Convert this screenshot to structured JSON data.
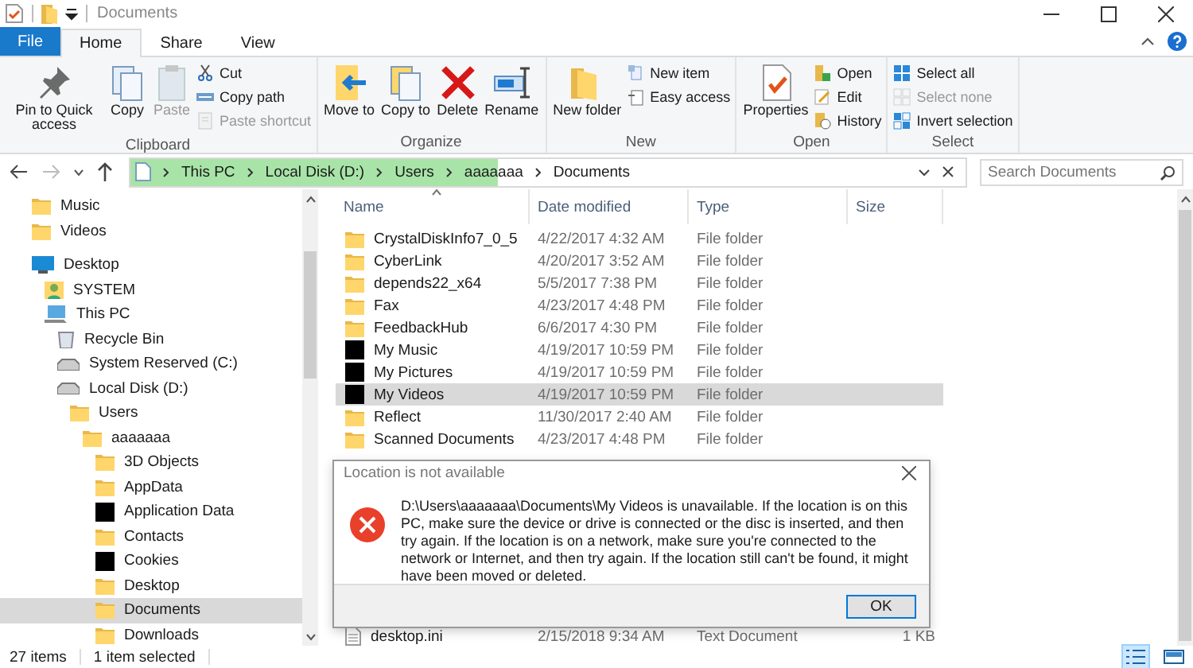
{
  "window": {
    "title": "Documents"
  },
  "tabs": [
    {
      "label": "File",
      "kind": "file-menu",
      "selected": false
    },
    {
      "label": "Home",
      "kind": "tab",
      "selected": true
    },
    {
      "label": "Share",
      "kind": "tab",
      "selected": false
    },
    {
      "label": "View",
      "kind": "tab",
      "selected": false
    }
  ],
  "ribbon": [
    {
      "label": "Clipboard",
      "large": [
        {
          "label": "Pin to Quick access",
          "kind": "pin",
          "disabled": false
        },
        {
          "label": "Copy",
          "kind": "copy",
          "disabled": false
        },
        {
          "label": "Paste",
          "kind": "paste",
          "disabled": true
        }
      ],
      "small": [
        {
          "label": "Cut",
          "kind": "cut",
          "disabled": false
        },
        {
          "label": "Copy path",
          "kind": "path",
          "disabled": false
        },
        {
          "label": "Paste shortcut",
          "kind": "shortcut",
          "disabled": true
        }
      ]
    },
    {
      "label": "Organize",
      "large": [
        {
          "label": "Move to",
          "kind": "move",
          "disabled": false
        },
        {
          "label": "Copy to",
          "kind": "copyto",
          "disabled": false
        },
        {
          "label": "Delete",
          "kind": "delete",
          "disabled": false
        },
        {
          "label": "Rename",
          "kind": "rename",
          "disabled": false
        }
      ]
    },
    {
      "label": "New",
      "large": [
        {
          "label": "New folder",
          "kind": "folder",
          "disabled": false
        }
      ],
      "small": [
        {
          "label": "New item",
          "kind": "newitem",
          "disabled": false
        },
        {
          "label": "Easy access",
          "kind": "easy",
          "disabled": false
        }
      ]
    },
    {
      "label": "Open",
      "large": [
        {
          "label": "Properties",
          "kind": "properties",
          "disabled": false
        }
      ],
      "small": [
        {
          "label": "Open",
          "kind": "open",
          "disabled": false
        },
        {
          "label": "Edit",
          "kind": "edit",
          "disabled": false
        },
        {
          "label": "History",
          "kind": "history",
          "disabled": false
        }
      ]
    },
    {
      "label": "Select",
      "small": [
        {
          "label": "Select all",
          "kind": "all",
          "disabled": false
        },
        {
          "label": "Select none",
          "kind": "none",
          "disabled": true
        },
        {
          "label": "Invert selection",
          "kind": "invert",
          "disabled": false
        }
      ]
    }
  ],
  "address_bar": {
    "level": 0.44,
    "crumbs": [
      "This PC",
      "Local Disk (D:)",
      "Users",
      "aaaaaaa",
      "Documents"
    ]
  },
  "search": {
    "placeholder": "Search Documents"
  },
  "nav_tree": [
    {
      "label": "Music",
      "kind": "folder",
      "selected": false
    },
    {
      "label": "Videos",
      "kind": "folder",
      "selected": false
    },
    {
      "label": "Desktop",
      "kind": "desktop",
      "selected": false,
      "children": [
        {
          "label": "SYSTEM",
          "kind": "user",
          "selected": false
        },
        {
          "label": "This PC",
          "kind": "pc",
          "selected": false,
          "children": [
            {
              "label": "Recycle Bin",
              "kind": "recycle",
              "selected": false
            },
            {
              "label": "System Reserved (C:)",
              "kind": "drive",
              "selected": false
            },
            {
              "label": "Local Disk (D:)",
              "kind": "drive",
              "selected": false,
              "children": [
                {
                  "label": "Users",
                  "kind": "folder",
                  "selected": false,
                  "children": [
                    {
                      "label": "aaaaaaa",
                      "kind": "folder",
                      "selected": false,
                      "children": [
                        {
                          "label": "3D Objects",
                          "kind": "folder",
                          "selected": false
                        },
                        {
                          "label": "AppData",
                          "kind": "folder",
                          "selected": false
                        },
                        {
                          "label": "Application Data",
                          "kind": "blocked",
                          "selected": false
                        },
                        {
                          "label": "Contacts",
                          "kind": "folder",
                          "selected": false
                        },
                        {
                          "label": "Cookies",
                          "kind": "blocked",
                          "selected": false
                        },
                        {
                          "label": "Desktop",
                          "kind": "folder",
                          "selected": false
                        },
                        {
                          "label": "Documents",
                          "kind": "folder",
                          "selected": true
                        },
                        {
                          "label": "Downloads",
                          "kind": "folder",
                          "selected": false
                        }
                      ]
                    }
                  ]
                }
              ]
            }
          ]
        }
      ]
    }
  ],
  "table": {
    "columns": [
      "Name",
      "Date modified",
      "Type",
      "Size"
    ],
    "rows": [
      {
        "name": "CrystalDiskInfo7_0_5",
        "date": "4/22/2017 4:32 AM",
        "type": "File folder",
        "kind": "folder",
        "selected": false
      },
      {
        "name": "CyberLink",
        "date": "4/20/2017 3:52 AM",
        "type": "File folder",
        "kind": "folder",
        "selected": false
      },
      {
        "name": "depends22_x64",
        "date": "5/5/2017 7:38 PM",
        "type": "File folder",
        "kind": "folder",
        "selected": false
      },
      {
        "name": "Fax",
        "date": "4/23/2017 4:48 PM",
        "type": "File folder",
        "kind": "folder",
        "selected": false
      },
      {
        "name": "FeedbackHub",
        "date": "6/6/2017 4:30 PM",
        "type": "File folder",
        "kind": "folder",
        "selected": false
      },
      {
        "name": "My Music",
        "date": "4/19/2017 10:59 PM",
        "type": "File folder",
        "kind": "blocked",
        "selected": false
      },
      {
        "name": "My Pictures",
        "date": "4/19/2017 10:59 PM",
        "type": "File folder",
        "kind": "blocked",
        "selected": false
      },
      {
        "name": "My Videos",
        "date": "4/19/2017 10:59 PM",
        "type": "File folder",
        "kind": "blocked",
        "selected": true
      },
      {
        "name": "Reflect",
        "date": "11/30/2017 2:40 AM",
        "type": "File folder",
        "kind": "folder",
        "selected": false
      },
      {
        "name": "Scanned Documents",
        "date": "4/23/2017 4:48 PM",
        "type": "File folder",
        "kind": "folder",
        "selected": false
      }
    ],
    "bottom_rows": [
      {
        "name": "desktop.ini",
        "date": "2/15/2018 9:34 AM",
        "type": "Text Document",
        "size": "1 KB",
        "kind": "text",
        "selected": false
      }
    ]
  },
  "dialog": {
    "title": "Location is not available",
    "message": "D:\\Users\\aaaaaaa\\Documents\\My Videos is unavailable. If the location is on this PC, make sure the device or drive is connected or the disc is inserted, and then try again. If the location is on a network, make sure you're connected to the network or Internet, and then try again. If the location still can't be found, it might have been moved or deleted.",
    "button": "OK"
  },
  "status_bar": {
    "count": "27 items",
    "selection": "1 item selected"
  }
}
